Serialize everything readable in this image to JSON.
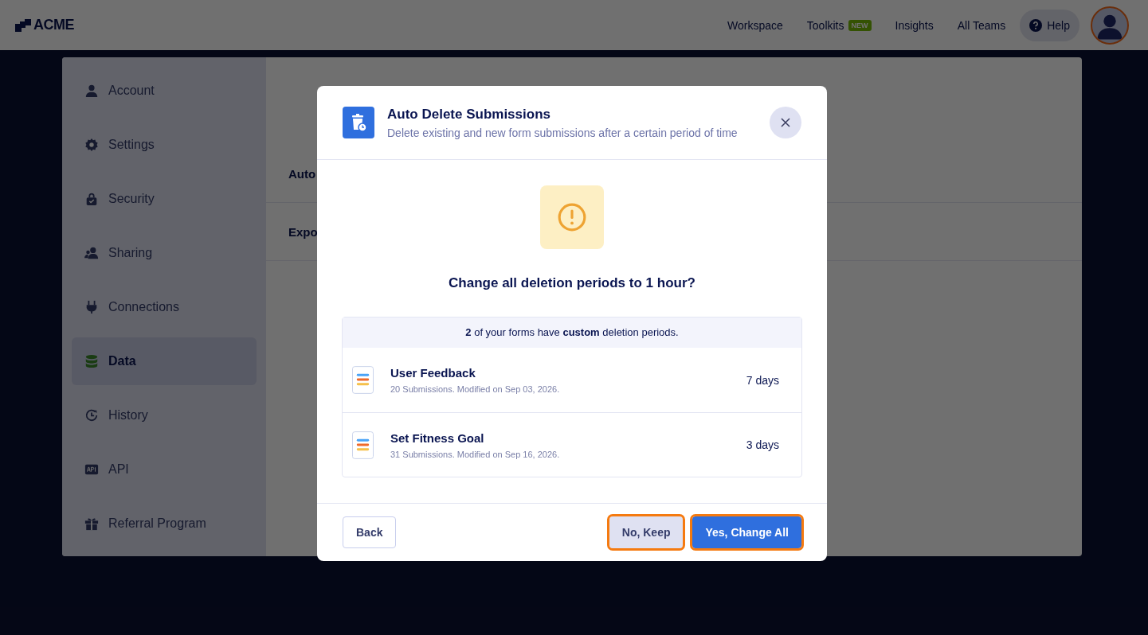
{
  "topbar": {
    "logo": "ACME",
    "nav": [
      {
        "label": "Workspace"
      },
      {
        "label": "Toolkits",
        "badge": "NEW"
      },
      {
        "label": "Insights"
      },
      {
        "label": "All Teams"
      }
    ],
    "help": "Help"
  },
  "sidebar": {
    "items": [
      {
        "kind": "person",
        "label": "Account",
        "selected": false
      },
      {
        "kind": "gear",
        "label": "Settings",
        "selected": false
      },
      {
        "kind": "lock",
        "label": "Security",
        "selected": false
      },
      {
        "kind": "people",
        "label": "Sharing",
        "selected": false
      },
      {
        "kind": "plug",
        "label": "Connections",
        "selected": false
      },
      {
        "kind": "database",
        "label": "Data",
        "selected": true
      },
      {
        "kind": "clock",
        "label": "History",
        "selected": false
      },
      {
        "kind": "api",
        "label": "API",
        "selected": false
      },
      {
        "kind": "gift",
        "label": "Referral Program",
        "selected": false
      }
    ]
  },
  "content": {
    "rows": [
      "Auto",
      "Expo"
    ]
  },
  "modal": {
    "title": "Auto Delete Submissions",
    "subtitle": "Delete existing and new form submissions after a certain period of time",
    "question": "Change all deletion periods to 1 hour?",
    "summary": "**2** of your forms have **custom** deletion periods.",
    "forms": [
      {
        "name": "User Feedback",
        "meta": "20 Submissions. Modified on Sep 03, 2026.",
        "period": "7 days"
      },
      {
        "name": "Set Fitness Goal",
        "meta": "31 Submissions. Modified on Sep 16, 2026.",
        "period": "3 days"
      }
    ],
    "buttons": [
      {
        "kind": "secondary",
        "label": "Back",
        "highlighted": false
      },
      {
        "kind": "muted",
        "label": "No, Keep",
        "highlighted": true
      },
      {
        "kind": "primary",
        "label": "Yes, Change All",
        "highlighted": true
      }
    ]
  }
}
